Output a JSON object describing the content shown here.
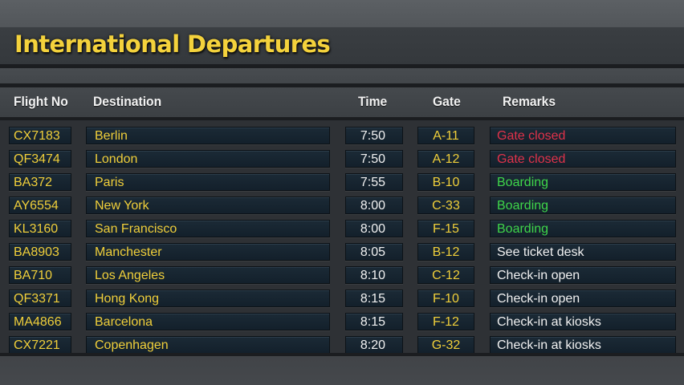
{
  "board": {
    "title": "International Departures",
    "columns": {
      "flight_no": "Flight No",
      "destination": "Destination",
      "time": "Time",
      "gate": "Gate",
      "remarks": "Remarks"
    },
    "remark_colors": {
      "Gate closed": "#e0324a",
      "Boarding": "#3fd64a",
      "default": "#f1f1f1"
    },
    "accent_color": "#f0cf3a",
    "rows": [
      {
        "flight_no": "CX7183",
        "destination": "Berlin",
        "time": "7:50",
        "gate": "A-11",
        "remarks": "Gate closed"
      },
      {
        "flight_no": "QF3474",
        "destination": "London",
        "time": "7:50",
        "gate": "A-12",
        "remarks": "Gate closed"
      },
      {
        "flight_no": "BA372",
        "destination": "Paris",
        "time": "7:55",
        "gate": "B-10",
        "remarks": "Boarding"
      },
      {
        "flight_no": "AY6554",
        "destination": "New York",
        "time": "8:00",
        "gate": "C-33",
        "remarks": "Boarding"
      },
      {
        "flight_no": "KL3160",
        "destination": "San Francisco",
        "time": "8:00",
        "gate": "F-15",
        "remarks": "Boarding"
      },
      {
        "flight_no": "BA8903",
        "destination": "Manchester",
        "time": "8:05",
        "gate": "B-12",
        "remarks": "See ticket desk"
      },
      {
        "flight_no": "BA710",
        "destination": "Los Angeles",
        "time": "8:10",
        "gate": "C-12",
        "remarks": "Check-in open"
      },
      {
        "flight_no": "QF3371",
        "destination": "Hong Kong",
        "time": "8:15",
        "gate": "F-10",
        "remarks": "Check-in open"
      },
      {
        "flight_no": "MA4866",
        "destination": "Barcelona",
        "time": "8:15",
        "gate": "F-12",
        "remarks": "Check-in at kiosks"
      },
      {
        "flight_no": "CX7221",
        "destination": "Copenhagen",
        "time": "8:20",
        "gate": "G-32",
        "remarks": "Check-in at kiosks"
      }
    ]
  }
}
